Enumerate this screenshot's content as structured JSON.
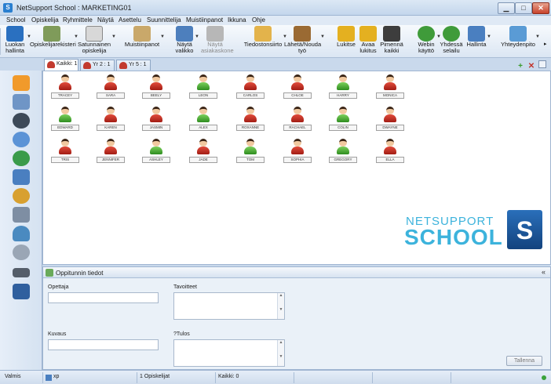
{
  "window": {
    "title": "NetSupport School : MARKETING01",
    "min": "▁",
    "max": "□",
    "close": "✕"
  },
  "menu": [
    "School",
    "Opiskelija",
    "Ryhmittele",
    "Näytä",
    "Asettelu",
    "Suunnittelija",
    "Muistiinpanot",
    "Ikkuna",
    "Ohje"
  ],
  "toolbar": [
    {
      "label": "Luokan\nhallinta",
      "icon": "class-control-icon",
      "color": "#2a70c0"
    },
    {
      "label": "Opiskelijarekisteri",
      "icon": "student-register-icon",
      "color": "#7f9b5a"
    },
    {
      "label": "Satunnainen\nopiskelija",
      "icon": "dice-icon",
      "color": "#d8d8d8"
    },
    {
      "label": "Muistiinpanot",
      "icon": "notebook-icon",
      "color": "#c9a86a"
    },
    {
      "label": "Näytä\nvalikko",
      "icon": "show-menu-icon",
      "color": "#4d7fbd"
    },
    {
      "label": "Näytä\nasiakaskone",
      "icon": "show-client-icon",
      "color": "#b7b7b7",
      "disabled": true
    },
    {
      "label": "Tiedostonsiirto",
      "icon": "file-transfer-icon",
      "color": "#e3b34b"
    },
    {
      "label": "Lähetä/Nouda\ntyö",
      "icon": "briefcase-icon",
      "color": "#9a6a33"
    },
    {
      "label": "Lukitse",
      "icon": "lock-icon",
      "color": "#e4b020"
    },
    {
      "label": "Avaa\nlukitus",
      "icon": "unlock-icon",
      "color": "#e4b020"
    },
    {
      "label": "Pimennä\nkaikki",
      "icon": "monitor-blank-icon",
      "color": "#3d3d3d"
    },
    {
      "label": "Webin\nkäyttö",
      "icon": "web-icon",
      "color": "#3f9b3a"
    },
    {
      "label": "Yhdessä\nselailu",
      "icon": "browse-together-icon",
      "color": "#3f9b3a"
    },
    {
      "label": "Hallinta",
      "icon": "management-icon",
      "color": "#4a7fc0"
    },
    {
      "label": "Yhteydenpito",
      "icon": "communication-icon",
      "color": "#5a9bd5"
    }
  ],
  "tabs": [
    {
      "label": "Kaikki: 1"
    },
    {
      "label": "Yr 2 : 1"
    },
    {
      "label": "Yr 5 : 1"
    }
  ],
  "sidebar": [
    "home-icon",
    "layout-icon",
    "headset-icon",
    "help-icon",
    "globe-icon",
    "window-icon",
    "chart-pie-icon",
    "printer-icon",
    "user-icon",
    "disc-icon",
    "keyboard-icon",
    "graph-icon"
  ],
  "students": [
    {
      "name": "TRACEY",
      "color": "red"
    },
    {
      "name": "SARA",
      "color": "red"
    },
    {
      "name": "BEELY",
      "color": "red"
    },
    {
      "name": "LEON",
      "color": "green"
    },
    {
      "name": "CARLOS",
      "color": "red"
    },
    {
      "name": "CHLOE",
      "color": "red"
    },
    {
      "name": "HARRY",
      "color": "green"
    },
    {
      "name": "MONICA",
      "color": "red"
    },
    {
      "name": "EDWARD",
      "color": "green"
    },
    {
      "name": "KAREN",
      "color": "red"
    },
    {
      "name": "JASMIN",
      "color": "red"
    },
    {
      "name": "ALEX",
      "color": "green"
    },
    {
      "name": "ROXANNE",
      "color": "red"
    },
    {
      "name": "RACHAEL",
      "color": "red"
    },
    {
      "name": "COLIN",
      "color": "green"
    },
    {
      "name": "DWAYNE",
      "color": "red"
    },
    {
      "name": "TRIS",
      "color": "red"
    },
    {
      "name": "JENNIFER",
      "color": "red"
    },
    {
      "name": "ASHLEY",
      "color": "green"
    },
    {
      "name": "JADE",
      "color": "red"
    },
    {
      "name": "TOM",
      "color": "green"
    },
    {
      "name": "SOPHIA",
      "color": "red"
    },
    {
      "name": "GREGORY",
      "color": "green"
    },
    {
      "name": "ELLA",
      "color": "red"
    }
  ],
  "logo": {
    "top": "NETSUPPORT",
    "bottom": "SCHOOL",
    "badge": "S"
  },
  "info": {
    "title": "Oppitunnin tiedot",
    "teacher_label": "Opettaja",
    "teacher_value": "",
    "goals_label": "Tavoitteet",
    "goals_value": "",
    "desc_label": "Kuvaus",
    "desc_value": "",
    "result_label": "?Tulos",
    "result_value": "",
    "save": "Tallenna"
  },
  "status": {
    "ready": "Valmis",
    "machine": "xp",
    "students": "1 Opiskelijat",
    "all": "Kaikki: 0"
  }
}
